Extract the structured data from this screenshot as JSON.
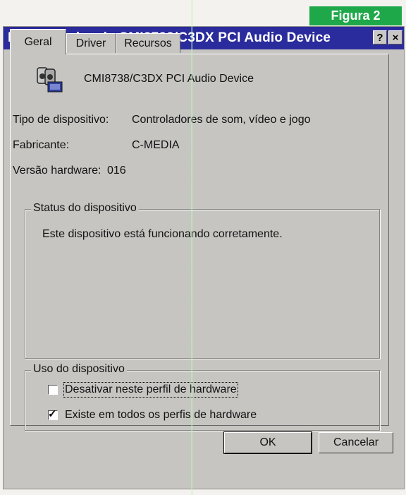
{
  "figure_label": "Figura 2",
  "window": {
    "title": "Propriedades de CMI8738/C3DX PCI Audio Device",
    "help_glyph": "?",
    "close_glyph": "×"
  },
  "tabs": [
    {
      "label": "Geral",
      "active": true
    },
    {
      "label": "Driver",
      "active": false
    },
    {
      "label": "Recursos",
      "active": false
    }
  ],
  "device": {
    "icon": "audio-device-icon",
    "name": "CMI8738/C3DX PCI Audio Device"
  },
  "properties": {
    "type_label": "Tipo de dispositivo:",
    "type_value": "Controladores de som, vídeo e jogo",
    "manufacturer_label": "Fabricante:",
    "manufacturer_value": "C-MEDIA",
    "hardware_label": "Versão hardware:",
    "hardware_value": "016"
  },
  "status": {
    "title": "Status do dispositivo",
    "text": "Este dispositivo está funcionando corretamente."
  },
  "usage": {
    "title": "Uso do dispositivo",
    "options": [
      {
        "label": "Desativar neste perfil de hardware",
        "checked": false
      },
      {
        "label": "Existe em todos os perfis de hardware",
        "checked": true
      }
    ]
  },
  "buttons": {
    "ok": "OK",
    "cancel": "Cancelar"
  }
}
